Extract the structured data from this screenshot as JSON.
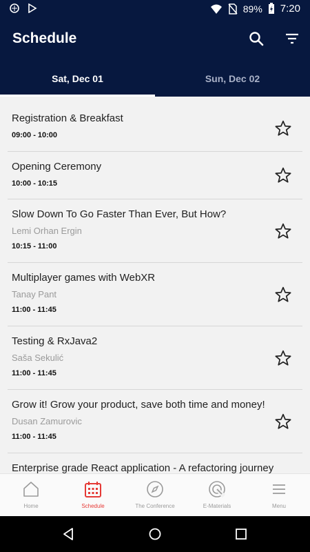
{
  "status_bar": {
    "battery": "89%",
    "time": "7:20"
  },
  "app_bar": {
    "title": "Schedule"
  },
  "tabs": [
    {
      "label": "Sat, Dec 01",
      "active": true
    },
    {
      "label": "Sun, Dec 02",
      "active": false
    }
  ],
  "sessions": [
    {
      "title": "Registration & Breakfast",
      "speaker": "",
      "time": "09:00 - 10:00"
    },
    {
      "title": "Opening Ceremony",
      "speaker": "",
      "time": "10:00 - 10:15"
    },
    {
      "title": "Slow Down To Go Faster Than Ever, But How?",
      "speaker": "Lemi Orhan Ergin",
      "time": "10:15 - 11:00"
    },
    {
      "title": "Multiplayer games with WebXR",
      "speaker": "Tanay Pant",
      "time": "11:00 - 11:45"
    },
    {
      "title": "Testing & RxJava2",
      "speaker": "Saša Sekulić",
      "time": "11:00 - 11:45"
    },
    {
      "title": "Grow it! Grow your product, save both time and money!",
      "speaker": "Dusan Zamurovic",
      "time": "11:00 - 11:45"
    },
    {
      "title": "Enterprise grade React application - A refactoring journey",
      "speaker": "",
      "time": ""
    }
  ],
  "bottom_nav": [
    {
      "label": "Home",
      "icon": "home-icon",
      "active": false
    },
    {
      "label": "Schedule",
      "icon": "calendar-icon",
      "active": true
    },
    {
      "label": "The Conference",
      "icon": "compass-icon",
      "active": false
    },
    {
      "label": "E-Materials",
      "icon": "e-materials-icon",
      "active": false
    },
    {
      "label": "Menu",
      "icon": "menu-icon",
      "active": false
    }
  ],
  "colors": {
    "primary": "#07183f",
    "accent": "#e53935",
    "background": "#f2f2f2"
  }
}
